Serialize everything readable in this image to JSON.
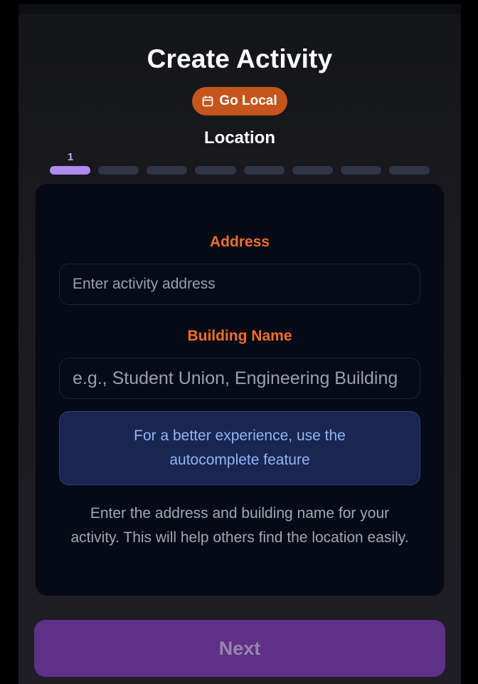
{
  "header": {
    "title": "Create Activity",
    "badge": {
      "label": "Go Local",
      "icon": "calendar-icon",
      "color": "#c4551c"
    },
    "step_title": "Location",
    "step_number": "1"
  },
  "progress": {
    "total_steps": 8,
    "current_step": 1,
    "active_color": "#b08af1",
    "inactive_color": "#2f3544"
  },
  "form": {
    "address_label": "Address",
    "address_placeholder": "Enter activity address",
    "address_value": "",
    "building_label": "Building Name",
    "building_placeholder": "e.g., Student Union, Engineering Building",
    "building_value": "",
    "label_color": "#ef6f2d",
    "info_message": "For a better experience, use the autocomplete feature",
    "help_text": "Enter the address and building name for your activity. This will help others find the location easily."
  },
  "footer": {
    "next_label": "Next",
    "next_color": "#5e3088"
  }
}
